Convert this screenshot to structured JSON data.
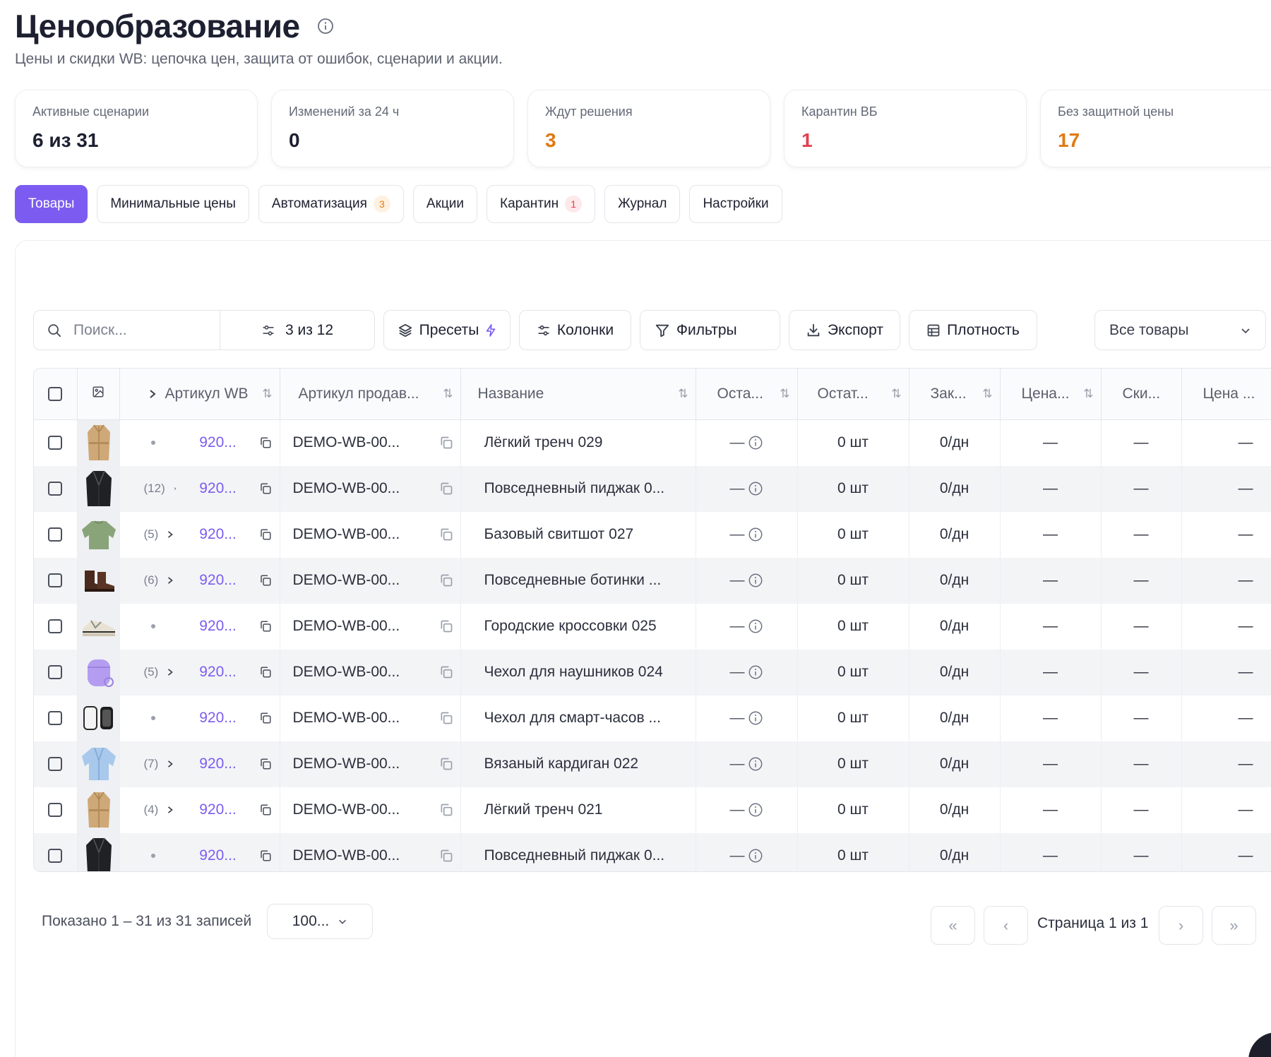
{
  "header": {
    "title": "Ценообразование",
    "subtitle": "Цены и скидки WB: цепочка цен, защита от ошибок, сценарии и акции."
  },
  "stats": [
    {
      "label": "Активные сценарии",
      "value": "6 из 31",
      "color": "#1d2030"
    },
    {
      "label": "Изменений за 24 ч",
      "value": "0",
      "color": "#1d2030"
    },
    {
      "label": "Ждут решения",
      "value": "3",
      "color": "#e07a12"
    },
    {
      "label": "Карантин ВБ",
      "value": "1",
      "color": "#e0414f"
    },
    {
      "label": "Без защитной цены",
      "value": "17",
      "color": "#e07a12"
    }
  ],
  "tabs": [
    {
      "label": "Товары",
      "active": true
    },
    {
      "label": "Минимальные цены"
    },
    {
      "label": "Автоматизация",
      "badge": "3"
    },
    {
      "label": "Акции"
    },
    {
      "label": "Карантин",
      "badge": "1"
    },
    {
      "label": "Журнал"
    },
    {
      "label": "Настройки"
    }
  ],
  "toolbar": {
    "search_placeholder": "Поиск...",
    "columns_count": "3 из 12",
    "presets": "Пресеты",
    "columns": "Колонки",
    "filters": "Фильтры",
    "export": "Экспорт",
    "density": "Плотность",
    "scope_select": "Все товары"
  },
  "table": {
    "headers": {
      "article_wb": "Артикул WB",
      "article_seller": "Артикул продав...",
      "name": "Название",
      "stock1": "Оста...",
      "stock2": "Остат...",
      "orders": "Зак...",
      "price": "Цена...",
      "discount": "Ски...",
      "price2": "Цена ..."
    },
    "rows": [
      {
        "group": "",
        "article": "920...",
        "seller": "DEMO-WB-00...",
        "name": "Лёгкий тренч 029",
        "stock1": "—",
        "stock2": "0 шт",
        "orders": "0/дн",
        "price": "—",
        "discount": "—",
        "price2": "—",
        "img": "coat"
      },
      {
        "group": "(12)",
        "article": "920...",
        "seller": "DEMO-WB-00...",
        "name": "Повседневный пиджак 0...",
        "stock1": "—",
        "stock2": "0 шт",
        "orders": "0/дн",
        "price": "—",
        "discount": "—",
        "price2": "—",
        "img": "jacket"
      },
      {
        "group": "(5)",
        "article": "920...",
        "seller": "DEMO-WB-00...",
        "name": "Базовый свитшот 027",
        "stock1": "—",
        "stock2": "0 шт",
        "orders": "0/дн",
        "price": "—",
        "discount": "—",
        "price2": "—",
        "img": "sweat"
      },
      {
        "group": "(6)",
        "article": "920...",
        "seller": "DEMO-WB-00...",
        "name": "Повседневные ботинки ...",
        "stock1": "—",
        "stock2": "0 шт",
        "orders": "0/дн",
        "price": "—",
        "discount": "—",
        "price2": "—",
        "img": "boots"
      },
      {
        "group": "",
        "article": "920...",
        "seller": "DEMO-WB-00...",
        "name": "Городские кроссовки 025",
        "stock1": "—",
        "stock2": "0 шт",
        "orders": "0/дн",
        "price": "—",
        "discount": "—",
        "price2": "—",
        "img": "sneaker"
      },
      {
        "group": "(5)",
        "article": "920...",
        "seller": "DEMO-WB-00...",
        "name": "Чехол для наушников 024",
        "stock1": "—",
        "stock2": "0 шт",
        "orders": "0/дн",
        "price": "—",
        "discount": "—",
        "price2": "—",
        "img": "case"
      },
      {
        "group": "",
        "article": "920...",
        "seller": "DEMO-WB-00...",
        "name": "Чехол для смарт-часов ...",
        "stock1": "—",
        "stock2": "0 шт",
        "orders": "0/дн",
        "price": "—",
        "discount": "—",
        "price2": "—",
        "img": "watch"
      },
      {
        "group": "(7)",
        "article": "920...",
        "seller": "DEMO-WB-00...",
        "name": "Вязаный кардиган 022",
        "stock1": "—",
        "stock2": "0 шт",
        "orders": "0/дн",
        "price": "—",
        "discount": "—",
        "price2": "—",
        "img": "cardigan"
      },
      {
        "group": "(4)",
        "article": "920...",
        "seller": "DEMO-WB-00...",
        "name": "Лёгкий тренч 021",
        "stock1": "—",
        "stock2": "0 шт",
        "orders": "0/дн",
        "price": "—",
        "discount": "—",
        "price2": "—",
        "img": "coat"
      },
      {
        "group": "",
        "article": "920...",
        "seller": "DEMO-WB-00...",
        "name": "Повседневный пиджак 0...",
        "stock1": "—",
        "stock2": "0 шт",
        "orders": "0/дн",
        "price": "—",
        "discount": "—",
        "price2": "—",
        "img": "jacket"
      }
    ]
  },
  "footer": {
    "count_text": "Показано 1 – 31 из 31 записей",
    "page_size": "100...",
    "page_text": "Страница 1 из 1"
  },
  "colors": {
    "accent": "#7c5cf0",
    "warning": "#e07a12",
    "danger": "#e0414f"
  }
}
